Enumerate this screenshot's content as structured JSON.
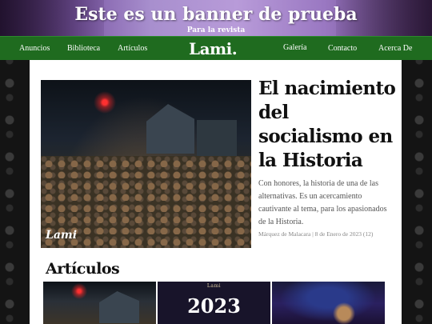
{
  "banner": {
    "title": "Este es un banner de prueba",
    "subtitle": "Para la revista"
  },
  "nav": {
    "items": [
      "Anuncios",
      "Biblioteca",
      "Artículos",
      "Galería",
      "Contacto",
      "Acerca De"
    ],
    "logo": "Lami."
  },
  "hero": {
    "image_watermark": "Lami",
    "title": "El nacimiento del socialismo en la Historia",
    "description": "Con honores, la historia de una de las alternativas. Es un acercamiento cautivante al tema, para los apasionados de la Historia.",
    "meta": "Márquez de Malacara | 8 de Enero de 2023 (12)"
  },
  "articles": {
    "section_title": "Artículos",
    "thumbs": [
      {
        "alt": "socialismo"
      },
      {
        "small_text": "Lami",
        "year": "2023"
      },
      {
        "alt": "galaxia"
      }
    ]
  },
  "colors": {
    "nav_bg": "#1f6b1f",
    "banner_accent": "#a88fce",
    "text_dark": "#111111",
    "text_muted": "#555555"
  }
}
